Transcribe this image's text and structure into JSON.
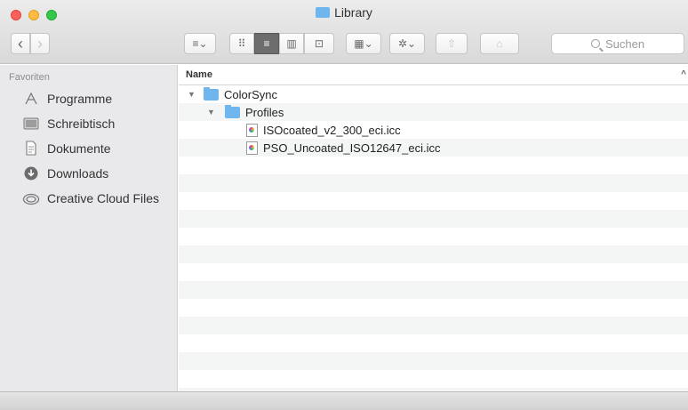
{
  "window": {
    "title": "Library"
  },
  "toolbar": {
    "back_icon": "‹",
    "forward_icon": "›",
    "view_options_icon": "≡⌄",
    "icon_view_icon": "⠿",
    "list_view_icon": "≡",
    "column_view_icon": "▥",
    "coverflow_view_icon": "⊡",
    "arrange_icon": "▦⌄",
    "action_icon": "✲⌄",
    "share_icon": "⇧",
    "tag_icon": "⌂",
    "search_placeholder": "Suchen"
  },
  "sidebar": {
    "header": "Favoriten",
    "items": [
      {
        "label": "Programme",
        "icon": "applications-icon"
      },
      {
        "label": "Schreibtisch",
        "icon": "desktop-icon"
      },
      {
        "label": "Dokumente",
        "icon": "documents-icon"
      },
      {
        "label": "Downloads",
        "icon": "downloads-icon"
      },
      {
        "label": "Creative Cloud Files",
        "icon": "creative-cloud-icon"
      }
    ]
  },
  "list": {
    "column_name": "Name",
    "sort_indicator": "^",
    "rows": [
      {
        "label": "ColorSync",
        "kind": "folder",
        "level": 0,
        "expanded": true
      },
      {
        "label": "Profiles",
        "kind": "folder",
        "level": 1,
        "expanded": true
      },
      {
        "label": "ISOcoated_v2_300_eci.icc",
        "kind": "file",
        "level": 2
      },
      {
        "label": "PSO_Uncoated_ISO12647_eci.icc",
        "kind": "file",
        "level": 2
      }
    ]
  },
  "colors": {
    "folder": "#6fb6ee",
    "sidebar_bg": "#e9e9ec",
    "stripe": "#f4f5f5"
  }
}
